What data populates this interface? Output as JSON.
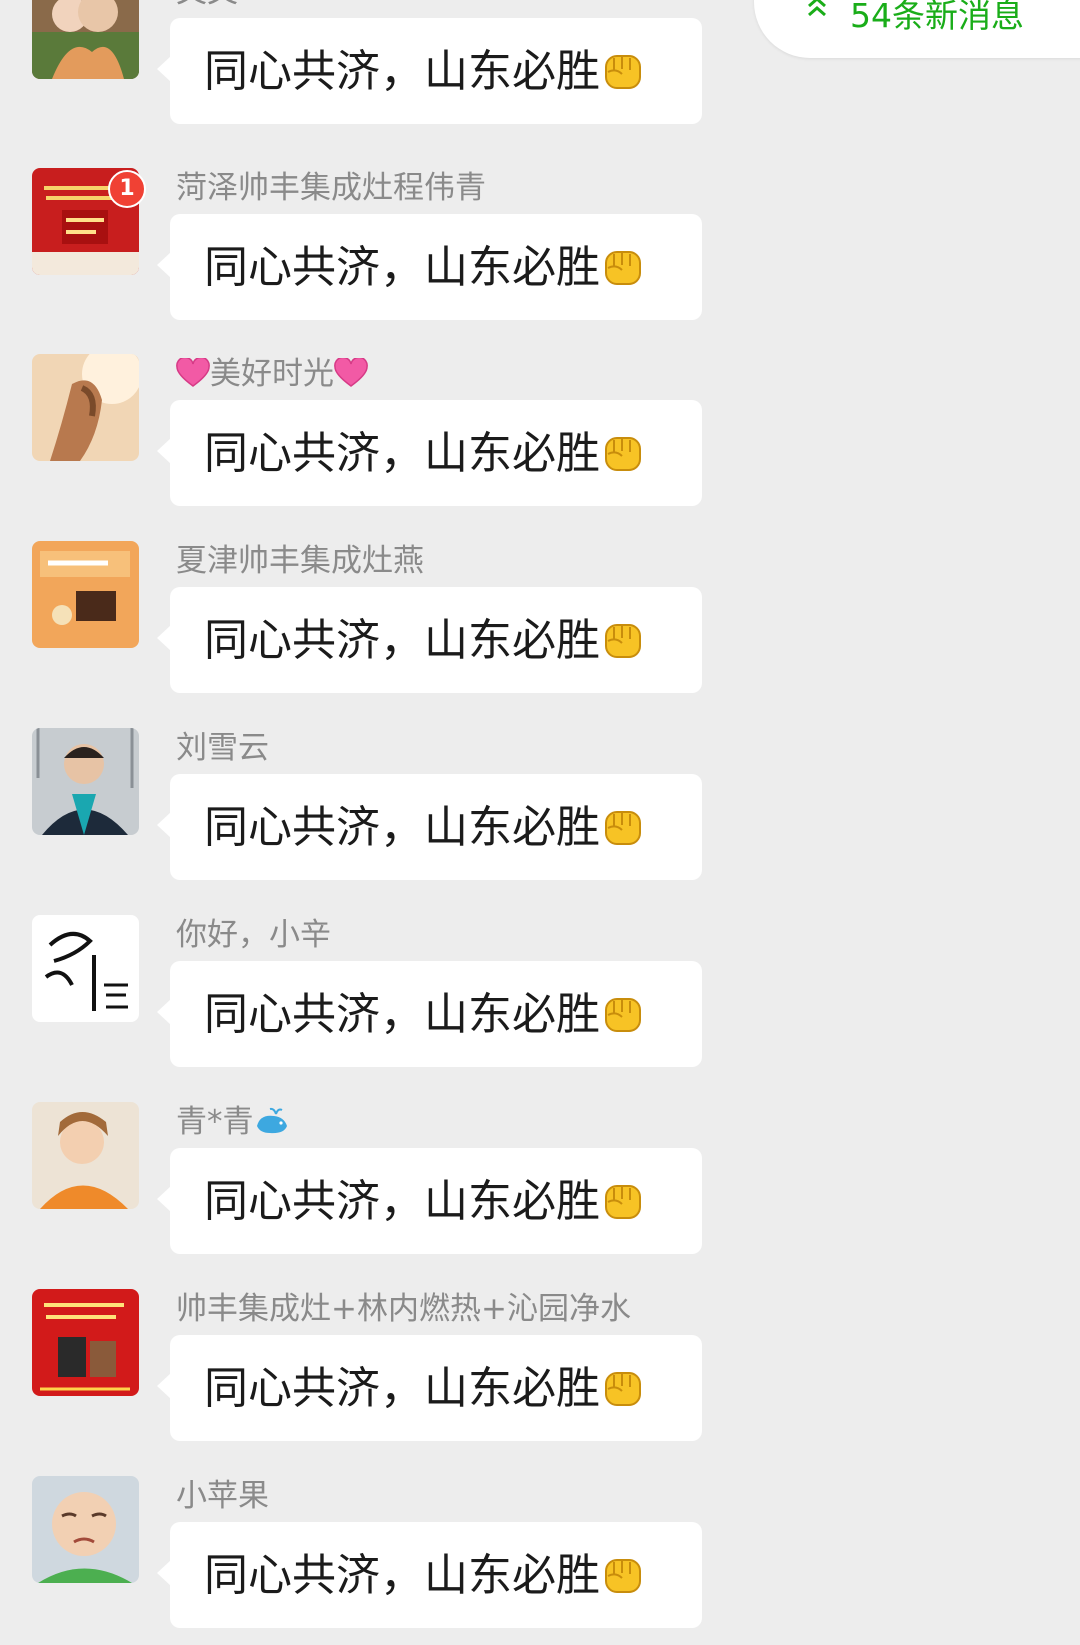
{
  "new_messages": {
    "label": "54条新消息",
    "color": "#1aad19"
  },
  "unread_badge": "1",
  "bubble_emoji": "fist-icon",
  "messages": [
    {
      "sender": "文文",
      "text": "同心共济，山东必胜"
    },
    {
      "sender": "菏泽帅丰集成灶程伟青",
      "text": "同心共济，山东必胜"
    },
    {
      "sender": "美好时光",
      "text": "同心共济，山东必胜"
    },
    {
      "sender": "夏津帅丰集成灶燕",
      "text": "同心共济，山东必胜"
    },
    {
      "sender": "刘雪云",
      "text": "同心共济，山东必胜"
    },
    {
      "sender": "你好，小辛",
      "text": "同心共济，山东必胜"
    },
    {
      "sender": "青*青",
      "text": "同心共济，山东必胜"
    },
    {
      "sender": "帅丰集成灶+林内燃热+沁园净水",
      "text": "同心共济，山东必胜"
    },
    {
      "sender": "小苹果",
      "text": "同心共济，山东必胜"
    }
  ]
}
